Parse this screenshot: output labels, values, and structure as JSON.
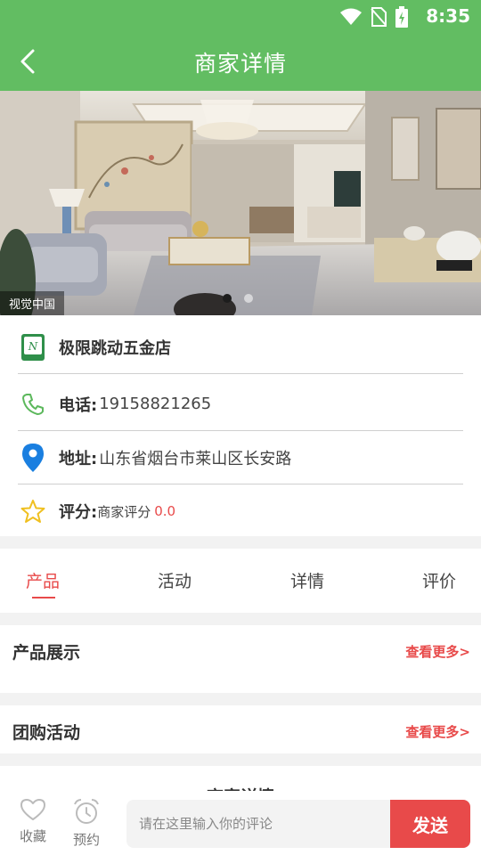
{
  "status": {
    "time": "8:35"
  },
  "header": {
    "title": "商家详情"
  },
  "banner": {
    "watermark": "视觉中国",
    "slides": 2,
    "active_slide": 1
  },
  "shop": {
    "name": "极限跳动五金店",
    "phone_label": "电话:",
    "phone": "19158821265",
    "address_label": "地址:",
    "address": "山东省烟台市莱山区长安路",
    "rating_label": "评分:",
    "rating_text": "商家评分",
    "rating_value": "0.0"
  },
  "tabs": [
    {
      "label": "产品",
      "active": true
    },
    {
      "label": "活动",
      "active": false
    },
    {
      "label": "详情",
      "active": false
    },
    {
      "label": "评价",
      "active": false
    }
  ],
  "sections": {
    "products": {
      "title": "产品展示",
      "more": "查看更多>"
    },
    "group": {
      "title": "团购活动",
      "more": "查看更多>"
    },
    "details_title": "商家详情"
  },
  "bottom": {
    "favorite": "收藏",
    "reserve": "预约",
    "comment_placeholder": "请在这里输入你的评论",
    "send": "发送"
  },
  "colors": {
    "header_green": "#62bd62",
    "accent_red": "#e84a4a"
  },
  "icons": [
    "wifi-icon",
    "no-sim-icon",
    "battery-icon",
    "back-arrow-icon",
    "shop-logo-icon",
    "phone-icon",
    "location-pin-icon",
    "star-icon",
    "heart-icon",
    "alarm-clock-icon"
  ]
}
